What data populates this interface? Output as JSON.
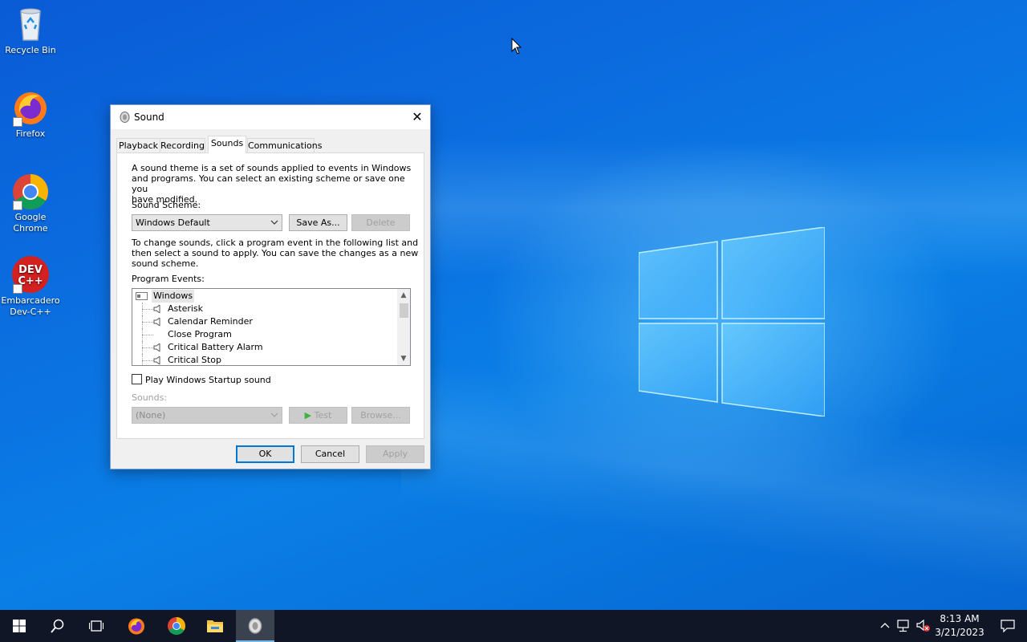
{
  "desktop": {
    "icons": [
      {
        "label": "Recycle Bin"
      },
      {
        "label": "Firefox"
      },
      {
        "label": "Google Chrome"
      },
      {
        "label": "Embarcadero Dev-C++"
      }
    ]
  },
  "dialog": {
    "title": "Sound",
    "tabs": [
      "Playback",
      "Recording",
      "Sounds",
      "Communications"
    ],
    "active_tab": "Sounds",
    "intro_text_lines": [
      "A sound theme is a set of sounds applied to events in Windows",
      "and programs.  You can select an existing scheme or save one you",
      "have modified."
    ],
    "scheme_label": "Sound Scheme:",
    "scheme_value": "Windows Default",
    "save_as_label": "Save As...",
    "delete_label": "Delete",
    "instructions_lines": [
      "To change sounds, click a program event in the following list and",
      "then select a sound to apply.  You can save the changes as a new",
      "sound scheme."
    ],
    "events_label": "Program Events:",
    "events": {
      "root": "Windows",
      "items": [
        {
          "label": "Asterisk",
          "has_sound": true
        },
        {
          "label": "Calendar Reminder",
          "has_sound": true
        },
        {
          "label": "Close Program",
          "has_sound": false
        },
        {
          "label": "Critical Battery Alarm",
          "has_sound": true
        },
        {
          "label": "Critical Stop",
          "has_sound": true
        }
      ]
    },
    "startup_sound_label": "Play Windows Startup sound",
    "startup_sound_checked": false,
    "sounds_label": "Sounds:",
    "sounds_value": "(None)",
    "test_label": "Test",
    "browse_label": "Browse...",
    "ok_label": "OK",
    "cancel_label": "Cancel",
    "apply_label": "Apply"
  },
  "taskbar": {
    "apps": [
      "start-icon",
      "search-icon",
      "task-view-icon",
      "firefox-icon",
      "chrome-icon",
      "file-explorer-icon",
      "sound-app-icon"
    ],
    "active_app": "sound-app-icon",
    "time": "8:13 AM",
    "date": "3/21/2023"
  },
  "colors": {
    "accent": "#0078d7",
    "taskbar": "#101626",
    "desktop": "#0a6fe0"
  }
}
